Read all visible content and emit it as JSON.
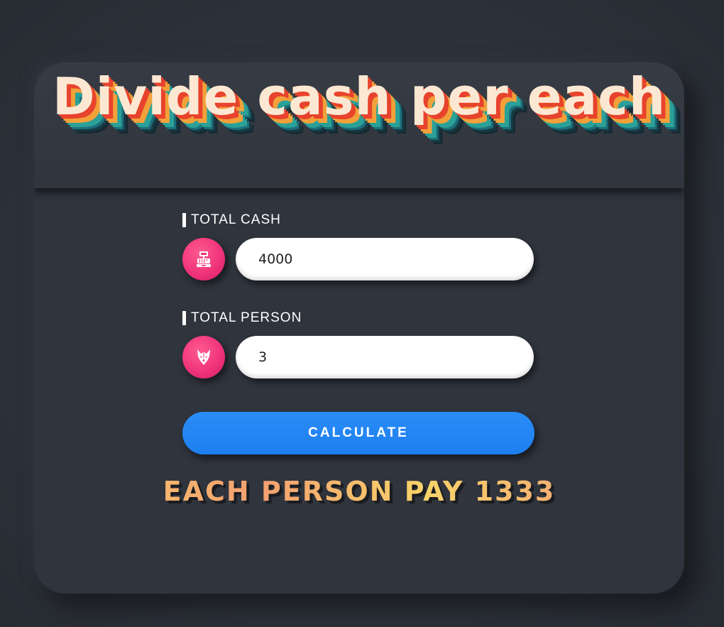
{
  "header": {
    "title": "Divide cash per each"
  },
  "form": {
    "total_cash": {
      "label": "TOTAL CASH",
      "value": "4000",
      "icon": "cash-register-icon"
    },
    "total_person": {
      "label": "TOTAL PERSON",
      "value": "3",
      "icon": "wolf-icon"
    },
    "calculate_label": "CALCULATE"
  },
  "result": {
    "text": "EACH PERSON PAY 1333"
  },
  "colors": {
    "background": "#2e333b",
    "card": "#2f343d",
    "icon_circle": "#f0357a",
    "button": "#1e7ff0",
    "title_text": "#fce8d2",
    "result_text": "#f6b26b"
  }
}
